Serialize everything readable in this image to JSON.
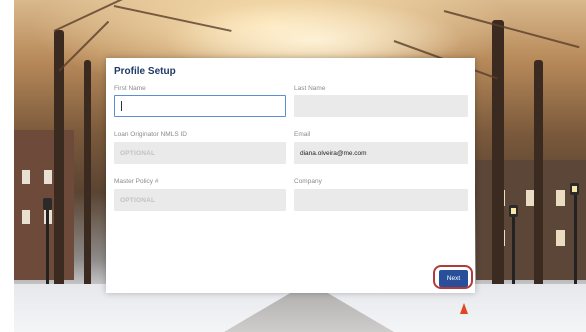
{
  "card": {
    "title": "Profile Setup",
    "fields": {
      "first_name": {
        "label": "First Name",
        "value": ""
      },
      "last_name": {
        "label": "Last Name",
        "value": ""
      },
      "nmls_id": {
        "label": "Loan Originator NMLS ID",
        "placeholder": "OPTIONAL"
      },
      "email": {
        "label": "Email",
        "value": "diana.olveira@me.com"
      },
      "master_policy": {
        "label": "Master Policy #",
        "placeholder": "OPTIONAL"
      },
      "company": {
        "label": "Company",
        "value": ""
      }
    },
    "next_label": "Next"
  },
  "colors": {
    "title": "#1f3a66",
    "button": "#2a4f9a",
    "focus_border": "#5b8fd0",
    "highlight_ring": "#b43a3a"
  }
}
